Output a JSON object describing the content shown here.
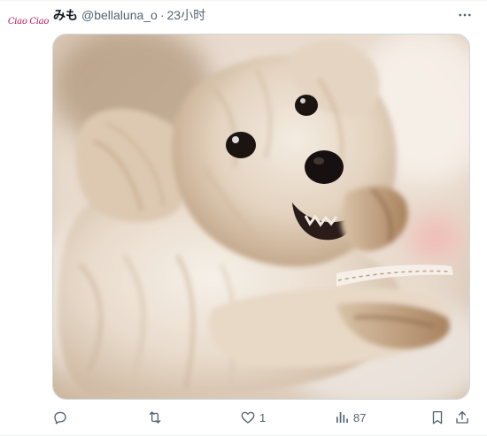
{
  "tweet": {
    "avatar_text": "Ciao Ciao",
    "display_name": "みも",
    "handle": "@bellaluna_o",
    "separator": "·",
    "timestamp": "23小时",
    "media": {
      "subject": "photo of a small fluffy cream-colored terrier dog lying down and looking at the camera"
    },
    "actions": {
      "reply": {
        "icon": "reply-icon",
        "count": ""
      },
      "retweet": {
        "icon": "retweet-icon",
        "count": ""
      },
      "like": {
        "icon": "heart-icon",
        "count": "1"
      },
      "views": {
        "icon": "views-chart-icon",
        "count": "87"
      },
      "bookmark": {
        "icon": "bookmark-icon"
      },
      "share": {
        "icon": "share-icon"
      }
    }
  },
  "colors": {
    "text_primary": "#0f1419",
    "text_secondary": "#536471",
    "border": "#cfd9de",
    "avatar_accent": "#c2185b"
  }
}
